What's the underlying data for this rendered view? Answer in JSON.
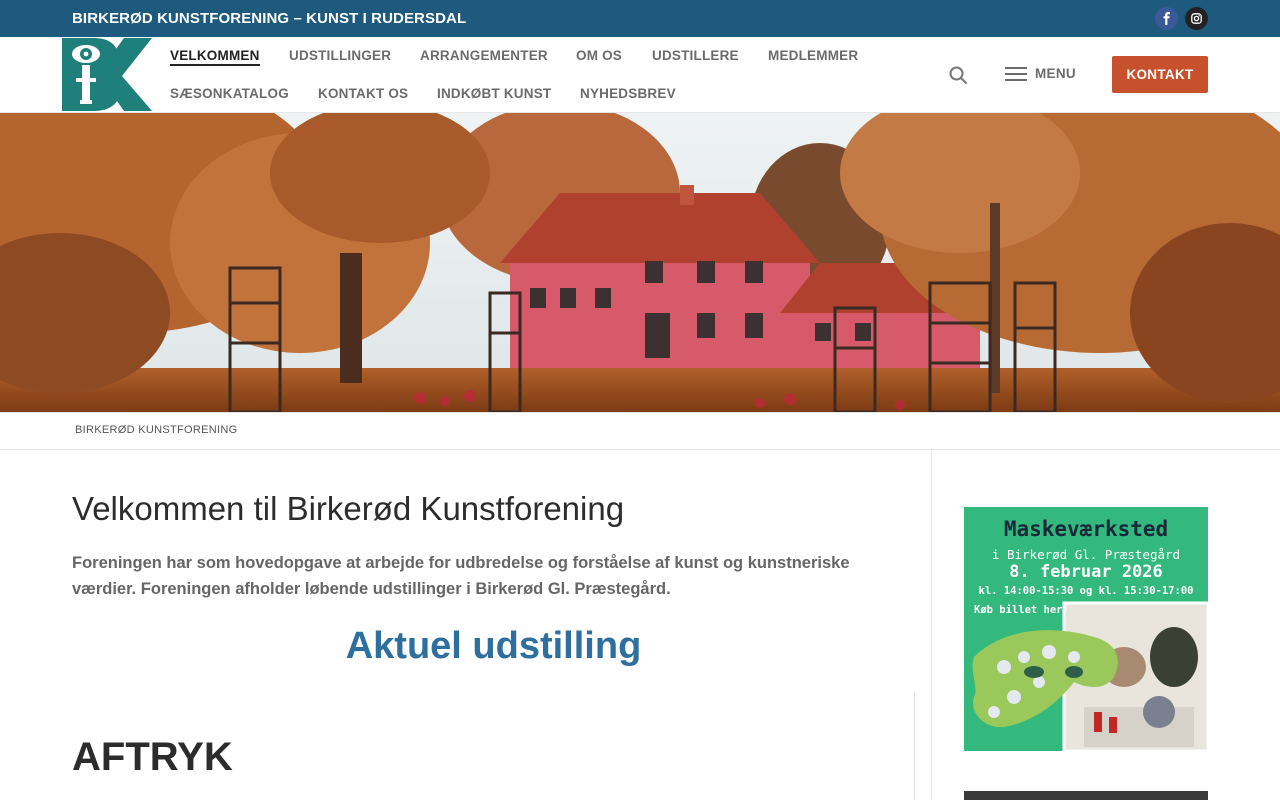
{
  "topbar": {
    "site_tagline": "BIRKERØD KUNSTFORENING – KUNST I RUDERSDAL",
    "facebook_icon": "facebook-icon",
    "instagram_icon": "instagram-icon"
  },
  "header": {
    "logo_icon": "bk-logo",
    "nav": [
      {
        "label": "VELKOMMEN"
      },
      {
        "label": "UDSTILLINGER"
      },
      {
        "label": "ARRANGEMENTER"
      },
      {
        "label": "OM OS"
      },
      {
        "label": "UDSTILLERE"
      },
      {
        "label": "MEDLEMMER"
      },
      {
        "label": "SÆSONKATALOG"
      },
      {
        "label": "KONTAKT OS"
      },
      {
        "label": "INDKØBT KUNST"
      },
      {
        "label": "NYHEDSBREV"
      }
    ],
    "menu_label": "MENU",
    "contact_label": "KONTAKT"
  },
  "breadcrumb": {
    "label": "BIRKERØD KUNSTFORENING"
  },
  "main": {
    "title": "Velkommen til Birkerød Kunstforening",
    "intro": "Foreningen har som hovedopgave at arbejde for udbredelse og forståelse af kunst og kunstneriske værdier. Foreningen afholder løbende udstillinger i Birkerød Gl. Præstegård.",
    "current_heading": "Aktuel udstilling",
    "exhibit_title": "AFTRYK"
  },
  "sidebar": {
    "promo": {
      "title": "Maskeværksted",
      "place": "i Birkerød Gl. Præstegård",
      "date": "8. februar 2026",
      "times": "kl. 14:00-15:30 og kl. 15:30-17:00",
      "cta": "Køb billet her!"
    }
  },
  "colors": {
    "topbar": "#1d5a7e",
    "accent": "#c7512c",
    "heading_blue": "#2d6f9e",
    "promo_green": "#2db27a"
  }
}
